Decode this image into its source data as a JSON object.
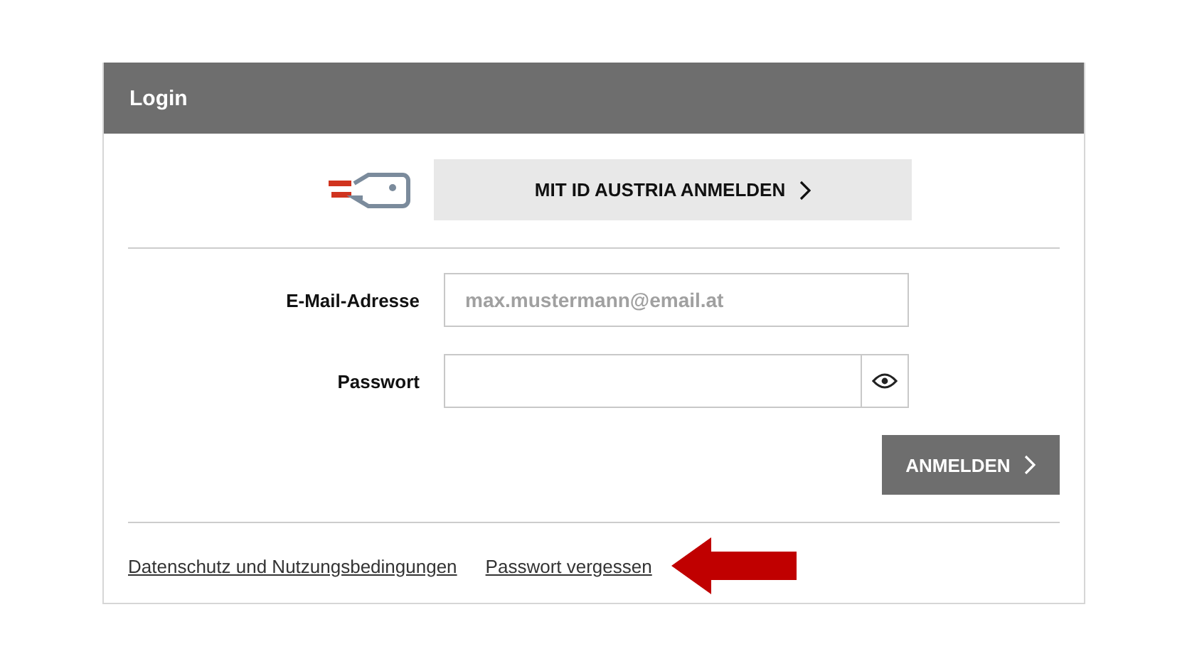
{
  "card": {
    "title": "Login"
  },
  "id_austria": {
    "label": "MIT ID AUSTRIA ANMELDEN"
  },
  "fields": [
    {
      "label": "E-Mail-Adresse",
      "placeholder": "max.mustermann@email.at",
      "kind": "text"
    },
    {
      "label": "Passwort",
      "kind": "password"
    }
  ],
  "submit": {
    "label": "ANMELDEN"
  },
  "links": [
    "Datenschutz und Nutzungsbedingungen",
    "Passwort vergessen"
  ]
}
